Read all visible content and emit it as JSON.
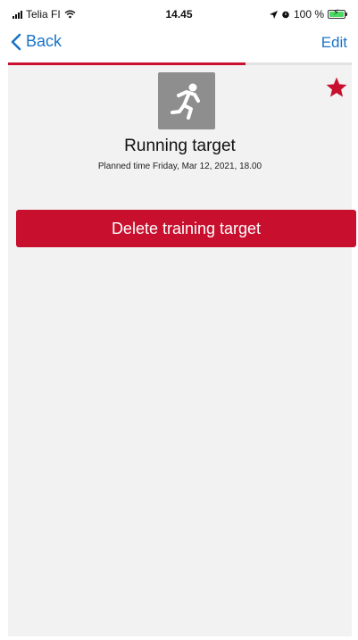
{
  "status_bar": {
    "carrier": "Telia FI",
    "time": "14.45",
    "battery": "100 %",
    "battery_level": 1.0
  },
  "nav": {
    "back_label": "Back",
    "edit_label": "Edit",
    "icons": {
      "back": "chevron-left-icon"
    }
  },
  "progress": {
    "value": 0.69
  },
  "target": {
    "icon": "running-person-icon",
    "favorite_icon": "star-icon",
    "title": "Running target",
    "planned_time": "Planned time Friday, Mar 12, 2021, 18.00"
  },
  "actions": {
    "delete_label": "Delete training target"
  },
  "colors": {
    "accent": "#c8102e",
    "link": "#1a73c8",
    "background": "#f2f2f2",
    "icon_bg": "#8e8e8e"
  }
}
